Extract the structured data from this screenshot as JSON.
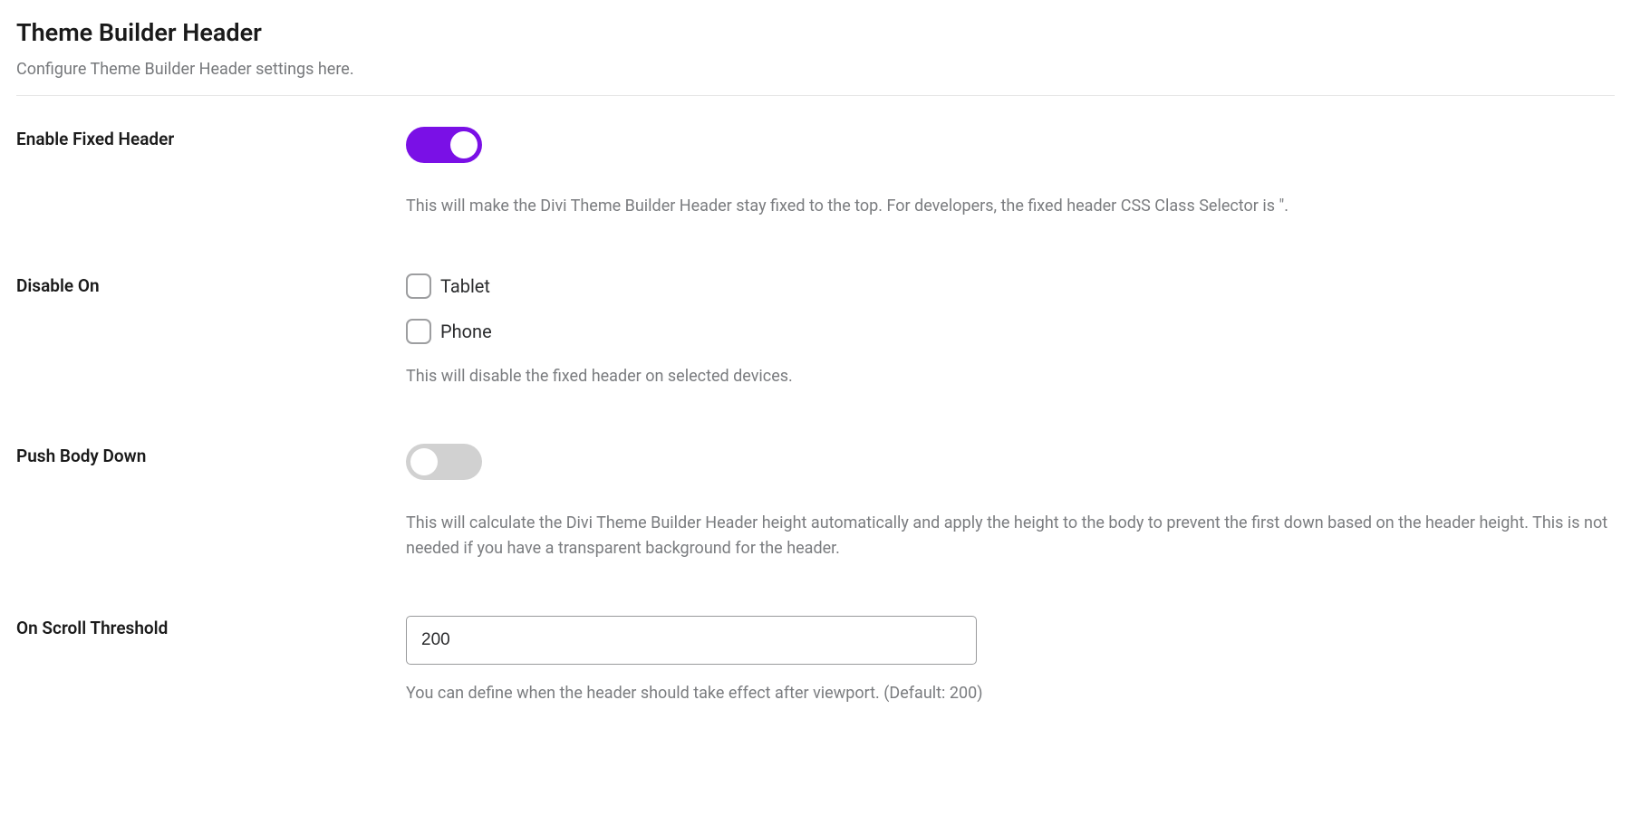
{
  "header": {
    "title": "Theme Builder Header",
    "subtitle": "Configure Theme Builder Header settings here."
  },
  "settings": {
    "enable_fixed_header": {
      "label": "Enable Fixed Header",
      "value": true,
      "description": "This will make the Divi Theme Builder Header stay fixed to the top. For developers, the fixed header CSS Class Selector is \"."
    },
    "disable_on": {
      "label": "Disable On",
      "options": [
        {
          "label": "Tablet",
          "checked": false
        },
        {
          "label": "Phone",
          "checked": false
        }
      ],
      "description": "This will disable the fixed header on selected devices."
    },
    "push_body_down": {
      "label": "Push Body Down",
      "value": false,
      "description": "This will calculate the Divi Theme Builder Header height automatically and apply the height to the body to prevent the first down based on the header height. This is not needed if you have a transparent background for the header."
    },
    "on_scroll_threshold": {
      "label": "On Scroll Threshold",
      "value": "200",
      "description": "You can define when the header should take effect after viewport. (Default: 200)"
    }
  }
}
